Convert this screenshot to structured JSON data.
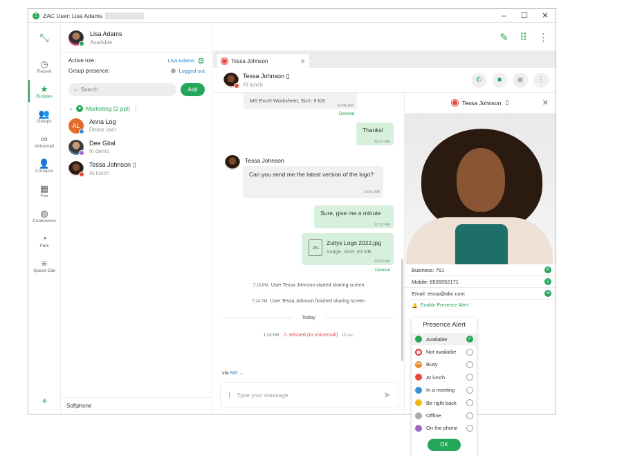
{
  "window": {
    "title": "ZAC User: Lisa Adams",
    "controls": [
      "–",
      "☐",
      "✕"
    ]
  },
  "nav": {
    "items": [
      {
        "label": "Recent",
        "icon": "◷"
      },
      {
        "label": "Buddies",
        "icon": "★"
      },
      {
        "label": "Groups",
        "icon": "👥"
      },
      {
        "label": "Voicemail",
        "icon": "∞"
      },
      {
        "label": "Contacts",
        "icon": "👤"
      },
      {
        "label": "Fax",
        "icon": "▦"
      },
      {
        "label": "Conference",
        "icon": "◍"
      },
      {
        "label": "Park",
        "icon": "◔"
      },
      {
        "label": "Speed Dial",
        "icon": "≡"
      }
    ]
  },
  "me": {
    "name": "Lisa Adams",
    "status": "Available"
  },
  "role": {
    "active_role_label": "Active role:",
    "active_role_value": "Lisa Adams",
    "group_presence_label": "Group presence:",
    "group_presence_value": "Logged out"
  },
  "search": {
    "placeholder": "Search",
    "add_label": "Add"
  },
  "group": {
    "name": "Marketing (2 ppl)"
  },
  "contacts": [
    {
      "name": "Anna Log",
      "status": "Demo user",
      "initials": "AL"
    },
    {
      "name": "Dee Gital",
      "status": "In demo"
    },
    {
      "name": "Tessa Johnson",
      "status": "At lunch"
    }
  ],
  "softphone": "Softphone",
  "tab": {
    "label": "Tessa Johnson"
  },
  "conversation": {
    "name": "Tessa Johnson",
    "status": "At lunch"
  },
  "messages": {
    "file1_caption": "MS Excel Worksheet, Size: 9 KB",
    "file1_time": "10:46 AM",
    "deleted1": "Deleted",
    "thanks": "Thanks!",
    "thanks_time": "10:47 AM",
    "sender": "Tessa Johnson",
    "question": "Can you send me the latest version of the logo?",
    "question_time": "10:51 AM",
    "reply": "Sure, give me a minute",
    "reply_time": "10:52 AM",
    "file2_name": "Zultys Logo 2022.jpg",
    "file2_caption": "Image, Size: 93 KB",
    "file2_time": "10:53 AM",
    "file2_badge": "JPG",
    "deleted2": "Deleted",
    "sys1_time": "7:23 PM",
    "sys1_text": "User Tessa Johnson started sharing screen",
    "sys2_time": "7:24 PM",
    "sys2_text": "User Tessa Johnson finished sharing screen",
    "today": "Today",
    "missed_time": "1:23 PM",
    "missed_text": "Missed (to voicemail)",
    "missed_dur": "13 sec"
  },
  "compose": {
    "via_label": "via",
    "via_value": "MX",
    "placeholder": "Type your message"
  },
  "card": {
    "name": "Tessa Johnson",
    "business": "Business: 761",
    "mobile": "Mobile: 6505552171",
    "email": "Email: tessa@abc.com",
    "presence_link": "Enable Presence Alert"
  },
  "presence_alert": {
    "title": "Presence Alert",
    "options": [
      {
        "label": "Available",
        "color": "#26a65b",
        "selected": true
      },
      {
        "label": "Not available",
        "color": "#d9342b",
        "selected": false
      },
      {
        "label": "Busy",
        "color": "#e6892b",
        "selected": false
      },
      {
        "label": "At lunch",
        "color": "#e34a3a",
        "selected": false
      },
      {
        "label": "In a meeting",
        "color": "#3d8fd6",
        "selected": false
      },
      {
        "label": "Be right back",
        "color": "#f2b61b",
        "selected": false
      },
      {
        "label": "Offline",
        "color": "#aaaaaa",
        "selected": false
      },
      {
        "label": "On the phone",
        "color": "#a066c9",
        "selected": false
      }
    ],
    "ok_label": "OK"
  }
}
